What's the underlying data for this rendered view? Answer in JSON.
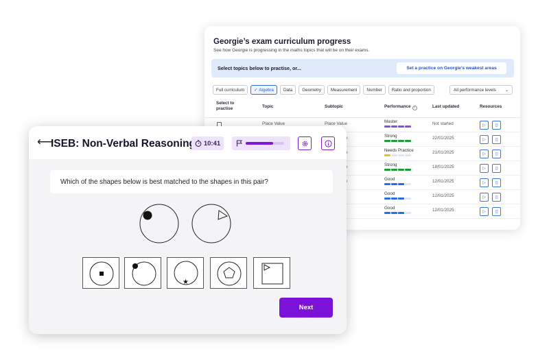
{
  "curriculum": {
    "title": "Georgie’s exam curriculum progress",
    "subtitle": "See how Georgie is progressing in the maths topics that will be on their exams.",
    "banner_text": "Select topics below to practise, or...",
    "banner_button": "Set a practice on Georgie’s weakest areas",
    "filters": [
      "Full curriculum",
      "Algebra",
      "Data",
      "Geometry",
      "Measurement",
      "Number",
      "Ratio and proportion"
    ],
    "active_filter": "Algebra",
    "level_select": "All performance levels",
    "columns": {
      "select": "Select to practise",
      "topic": "Topic",
      "subtopic": "Subtopic",
      "performance": "Performance",
      "updated": "Last updated",
      "resources": "Resources"
    },
    "rows": [
      {
        "topic": "Place Value",
        "subtopic": "Place Value",
        "performance": "Master",
        "level_color": "#8a4fd6",
        "filled": 4,
        "updated": "Not started"
      },
      {
        "topic": "",
        "subtopic": "e",
        "performance": "Strong",
        "level_color": "#1f9a3a",
        "filled": 4,
        "updated": "22/01/2025"
      },
      {
        "topic": "",
        "subtopic": "e",
        "performance": "Needs Practice",
        "level_color": "#f2b631",
        "filled": 1,
        "updated": "21/01/2025"
      },
      {
        "topic": "",
        "subtopic": "e",
        "performance": "Strong",
        "level_color": "#1f9a3a",
        "filled": 4,
        "updated": "18/01/2025"
      },
      {
        "topic": "",
        "subtopic": "e",
        "performance": "Good",
        "level_color": "#2c6ae0",
        "filled": 3,
        "updated": "12/01/2025"
      },
      {
        "topic": "",
        "subtopic": "",
        "performance": "Good",
        "level_color": "#2c6ae0",
        "filled": 3,
        "updated": "12/01/2025"
      },
      {
        "topic": "",
        "subtopic": "",
        "performance": "Good",
        "level_color": "#2c6ae0",
        "filled": 3,
        "updated": "12/01/2025"
      }
    ]
  },
  "quiz": {
    "title": "ISEB: Non-Verbal Reasoning",
    "timer": "10:41",
    "progress": 0.72,
    "question": "Which of the shapes below is best matched to the shapes in this pair?",
    "next_label": "Next",
    "accent": "#7c12d8"
  }
}
